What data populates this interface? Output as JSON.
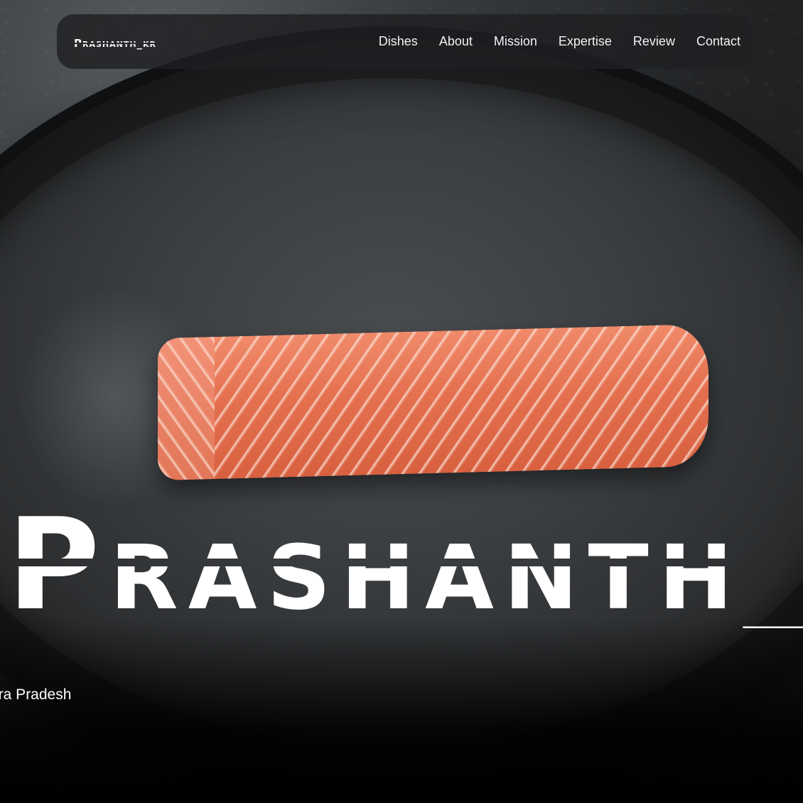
{
  "brand": {
    "name": "Prashanth_kr"
  },
  "nav": {
    "links": [
      "Dishes",
      "About",
      "Mission",
      "Expertise",
      "Review",
      "Contact"
    ]
  },
  "hero": {
    "title": "Prashanth_kr",
    "location": "hra Pradesh"
  },
  "colors": {
    "background": "#151617",
    "nav_background": "#1e2022",
    "text": "#ffffff",
    "salmon": "#e4704f"
  }
}
